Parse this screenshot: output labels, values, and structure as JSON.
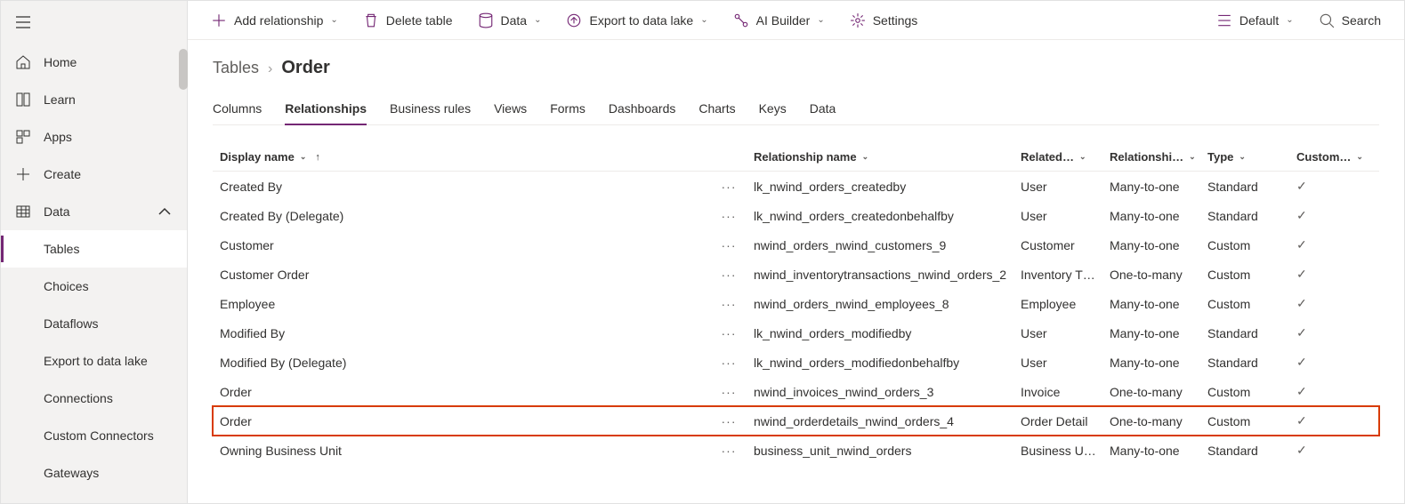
{
  "sidebar": {
    "items": [
      {
        "label": "Home"
      },
      {
        "label": "Learn"
      },
      {
        "label": "Apps"
      },
      {
        "label": "Create"
      },
      {
        "label": "Data"
      },
      {
        "label": "Tables"
      },
      {
        "label": "Choices"
      },
      {
        "label": "Dataflows"
      },
      {
        "label": "Export to data lake"
      },
      {
        "label": "Connections"
      },
      {
        "label": "Custom Connectors"
      },
      {
        "label": "Gateways"
      }
    ]
  },
  "commands": {
    "addRelationship": "Add relationship",
    "deleteTable": "Delete table",
    "data": "Data",
    "export": "Export to data lake",
    "aiBuilder": "AI Builder",
    "settings": "Settings",
    "viewMode": "Default",
    "search": "Search"
  },
  "breadcrumb": {
    "root": "Tables",
    "current": "Order"
  },
  "pivots": [
    "Columns",
    "Relationships",
    "Business rules",
    "Views",
    "Forms",
    "Dashboards",
    "Charts",
    "Keys",
    "Data"
  ],
  "activePivot": "Relationships",
  "table": {
    "headers": {
      "displayName": "Display name",
      "relationshipName": "Relationship name",
      "related": "Related…",
      "relationshipType": "Relationshi…",
      "type": "Type",
      "custom": "Custom…"
    },
    "rows": [
      {
        "display": "Created By",
        "rel": "lk_nwind_orders_createdby",
        "related": "User",
        "relType": "Many-to-one",
        "type": "Standard",
        "highlight": false
      },
      {
        "display": "Created By (Delegate)",
        "rel": "lk_nwind_orders_createdonbehalfby",
        "related": "User",
        "relType": "Many-to-one",
        "type": "Standard",
        "highlight": false
      },
      {
        "display": "Customer",
        "rel": "nwind_orders_nwind_customers_9",
        "related": "Customer",
        "relType": "Many-to-one",
        "type": "Custom",
        "highlight": false
      },
      {
        "display": "Customer Order",
        "rel": "nwind_inventorytransactions_nwind_orders_2",
        "related": "Inventory T…",
        "relType": "One-to-many",
        "type": "Custom",
        "highlight": false
      },
      {
        "display": "Employee",
        "rel": "nwind_orders_nwind_employees_8",
        "related": "Employee",
        "relType": "Many-to-one",
        "type": "Custom",
        "highlight": false
      },
      {
        "display": "Modified By",
        "rel": "lk_nwind_orders_modifiedby",
        "related": "User",
        "relType": "Many-to-one",
        "type": "Standard",
        "highlight": false
      },
      {
        "display": "Modified By (Delegate)",
        "rel": "lk_nwind_orders_modifiedonbehalfby",
        "related": "User",
        "relType": "Many-to-one",
        "type": "Standard",
        "highlight": false
      },
      {
        "display": "Order",
        "rel": "nwind_invoices_nwind_orders_3",
        "related": "Invoice",
        "relType": "One-to-many",
        "type": "Custom",
        "highlight": false
      },
      {
        "display": "Order",
        "rel": "nwind_orderdetails_nwind_orders_4",
        "related": "Order Detail",
        "relType": "One-to-many",
        "type": "Custom",
        "highlight": true
      },
      {
        "display": "Owning Business Unit",
        "rel": "business_unit_nwind_orders",
        "related": "Business U…",
        "relType": "Many-to-one",
        "type": "Standard",
        "highlight": false
      }
    ]
  }
}
